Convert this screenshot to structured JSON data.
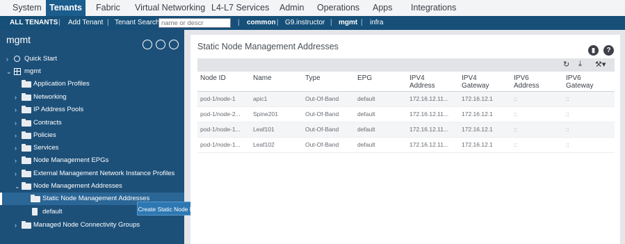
{
  "topnav": {
    "tabs": [
      {
        "label": "System",
        "active": false
      },
      {
        "label": "Tenants",
        "active": true
      },
      {
        "label": "Fabric",
        "active": false
      },
      {
        "label": "Virtual Networking",
        "active": false
      },
      {
        "label": "L4-L7 Services",
        "active": false
      },
      {
        "label": "Admin",
        "active": false
      },
      {
        "label": "Operations",
        "active": false
      },
      {
        "label": "Apps",
        "active": false
      },
      {
        "label": "Integrations",
        "active": false
      }
    ]
  },
  "tenantbar": {
    "all_tenants": "ALL TENANTS",
    "add_tenant": "Add Tenant",
    "search_label": "Tenant Search:",
    "search_placeholder": "name or descr",
    "common": "common",
    "instructor": "G9.instructor",
    "mgmt": "mgmt",
    "infra": "infra",
    "separator": "|"
  },
  "sidebar": {
    "title": "mgmt",
    "tree": [
      {
        "label": "Quick Start",
        "icon": "quick-start-icon",
        "chevron": "›"
      },
      {
        "label": "mgmt",
        "icon": "tenant-grid-icon",
        "chevron": "⌄"
      },
      {
        "label": "Application Profiles",
        "icon": "folder-icon",
        "chevron": ""
      },
      {
        "label": "Networking",
        "icon": "folder-icon",
        "chevron": "›"
      },
      {
        "label": "IP Address Pools",
        "icon": "folder-icon",
        "chevron": "›"
      },
      {
        "label": "Contracts",
        "icon": "folder-icon",
        "chevron": "›"
      },
      {
        "label": "Policies",
        "icon": "folder-icon",
        "chevron": "›"
      },
      {
        "label": "Services",
        "icon": "folder-icon",
        "chevron": "›"
      },
      {
        "label": "Node Management EPGs",
        "icon": "folder-icon",
        "chevron": "›"
      },
      {
        "label": "External Management Network Instance Profiles",
        "icon": "folder-icon",
        "chevron": "›"
      },
      {
        "label": "Node Management Addresses",
        "icon": "folder-icon",
        "chevron": "⌄"
      },
      {
        "label": "Static Node Management Addresses",
        "icon": "folder-icon",
        "chevron": ""
      },
      {
        "label": "default",
        "icon": "document-icon",
        "chevron": ""
      },
      {
        "label": "Managed Node Connectivity Groups",
        "icon": "folder-icon",
        "chevron": "›"
      }
    ],
    "tooltip": "Create Static Node Management Addresses"
  },
  "main": {
    "title": "Static Node Management Addresses",
    "columns": [
      "Node ID",
      "Name",
      "Type",
      "EPG",
      "IPV4 Address",
      "IPV4 Gateway",
      "IPV6 Address",
      "IPV6 Gateway"
    ],
    "rows": [
      [
        "pod-1/node-1",
        "apic1",
        "Out-Of-Band",
        "default",
        "172.16.12.11...",
        "172.16.12.1",
        "::",
        "::"
      ],
      [
        "pod-1/node-2...",
        "Spine201",
        "Out-Of-Band",
        "default",
        "172.16.12.11...",
        "172.16.12.1",
        "::",
        "::"
      ],
      [
        "pod-1/node-1...",
        "Leaf101",
        "Out-Of-Band",
        "default",
        "172.16.12.11...",
        "172.16.12.1",
        "::",
        "::"
      ],
      [
        "pod-1/node-1...",
        "Leaf102",
        "Out-Of-Band",
        "default",
        "172.16.12.11...",
        "172.16.12.1",
        "::",
        "::"
      ]
    ]
  },
  "colors": {
    "sidebar": "#1d5079",
    "tenantbar": "#164f78",
    "active_tab": "#1b5d8c",
    "tooltip": "#2d77b2"
  }
}
